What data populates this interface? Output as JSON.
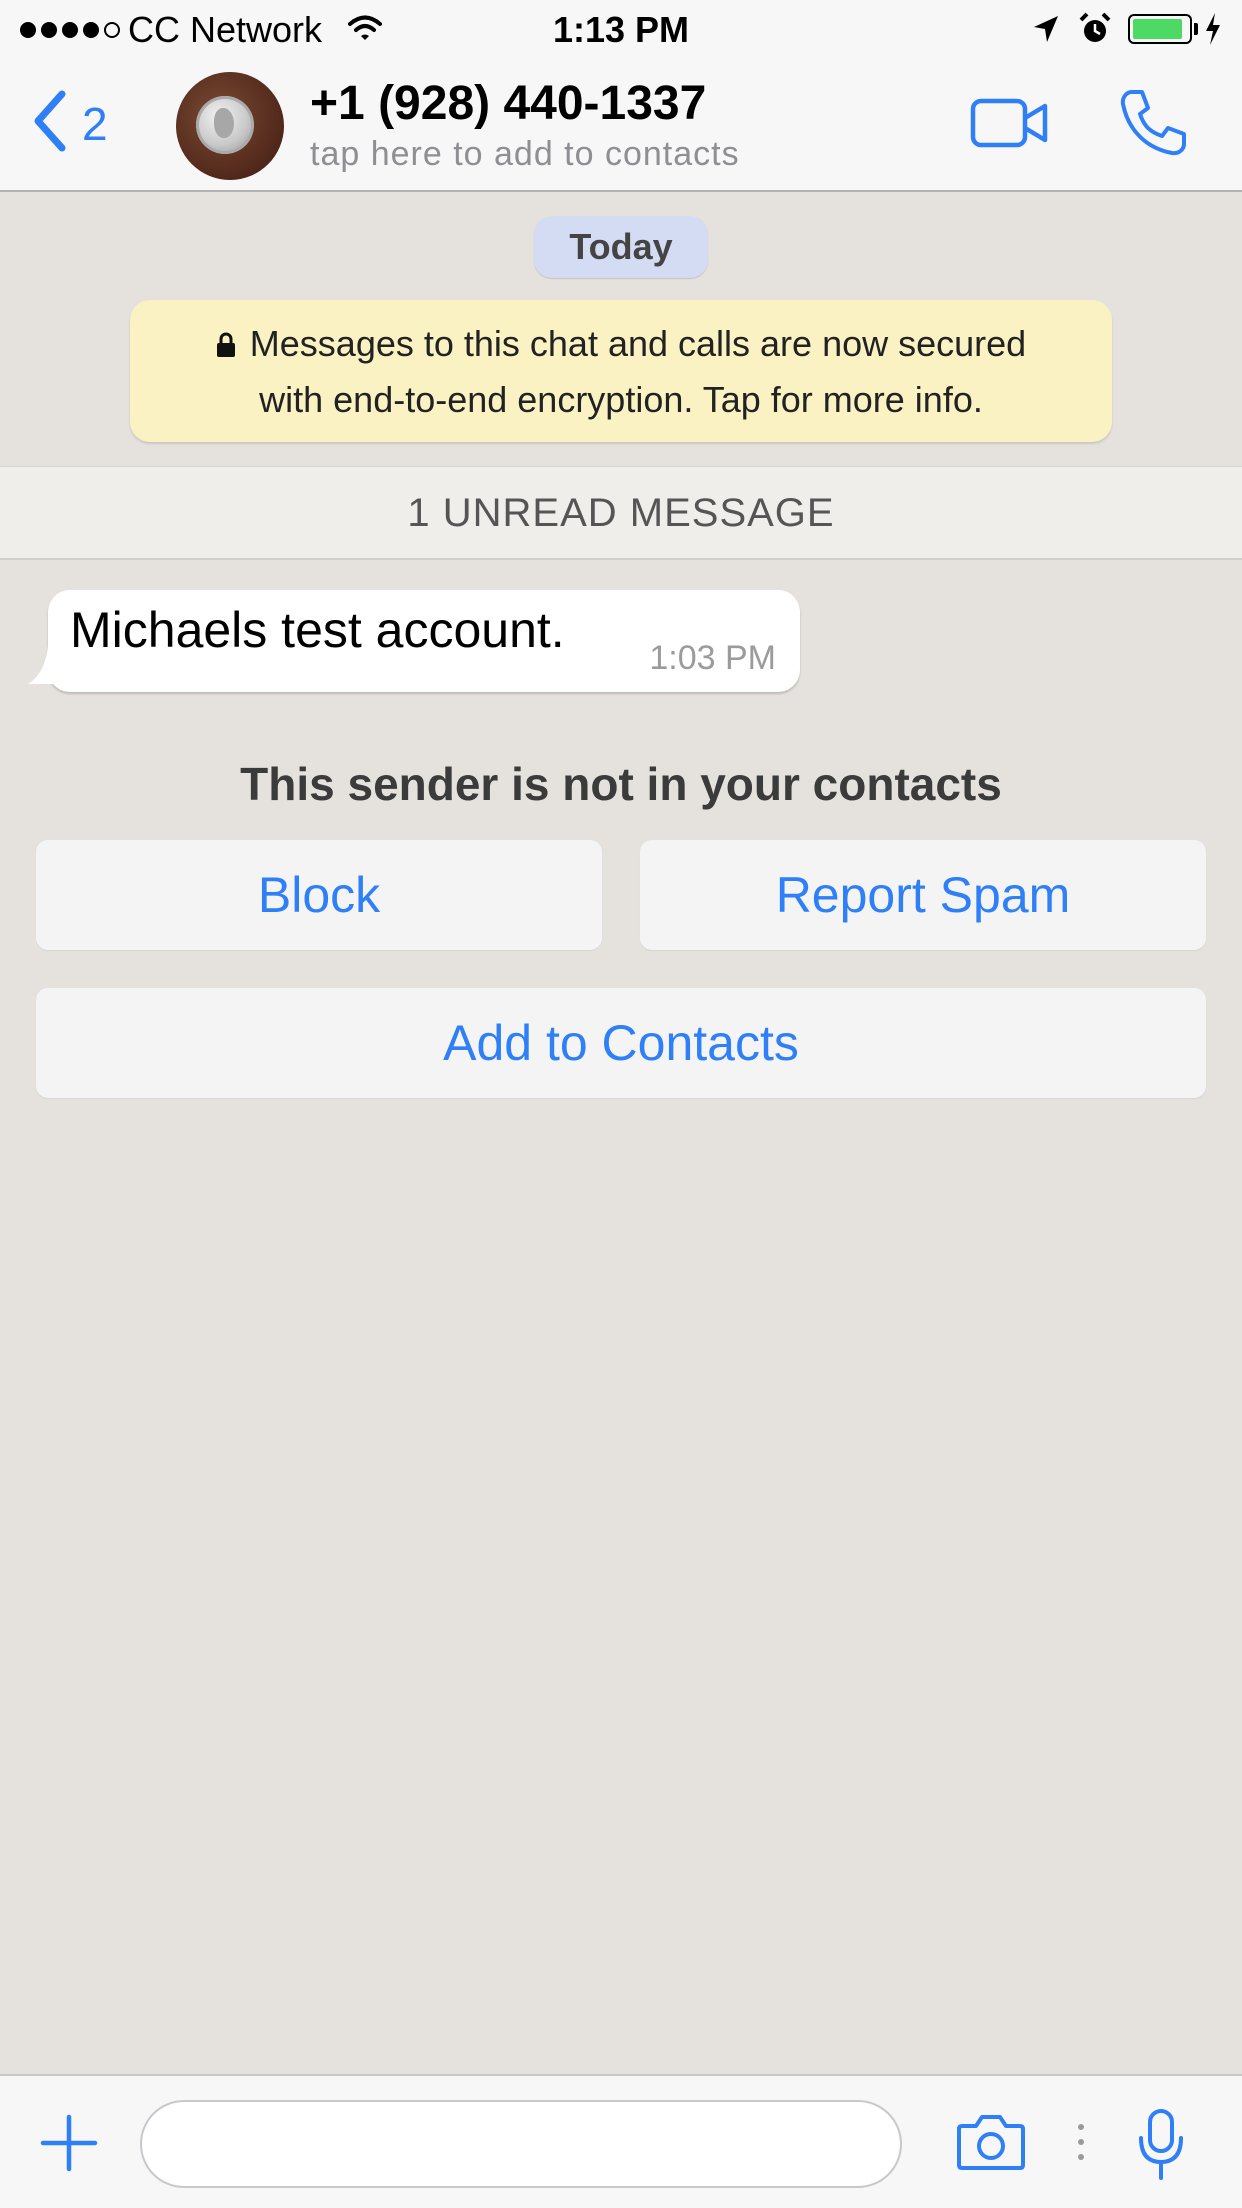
{
  "status_bar": {
    "carrier": "CC Network",
    "time": "1:13 PM",
    "signal_bars_filled": 4,
    "signal_bars_total": 5,
    "battery_level": 0.9,
    "icons": [
      "wifi-icon",
      "location-arrow-icon",
      "alarm-clock-icon",
      "battery-icon",
      "charging-bolt-icon"
    ]
  },
  "nav": {
    "back_count": "2",
    "contact_name": "+1 (928) 440-1337",
    "contact_subtitle": "tap here to add to contacts",
    "icons": [
      "chevron-left-icon",
      "video-camera-icon",
      "phone-icon"
    ]
  },
  "chat": {
    "date_label": "Today",
    "encryption_notice": {
      "line1": "Messages to this chat and calls are now secured",
      "line2": "with end-to-end encryption. Tap for more info."
    },
    "unread_label": "1 UNREAD MESSAGE",
    "messages": [
      {
        "text": "Michaels test account.",
        "time": "1:03 PM",
        "direction": "incoming"
      }
    ],
    "sender_notice": "This sender is not in your contacts",
    "actions": {
      "block": "Block",
      "report_spam": "Report Spam",
      "add_to_contacts": "Add to Contacts"
    }
  },
  "composer": {
    "input_value": "",
    "icons": [
      "plus-icon",
      "camera-icon",
      "more-dots-icon",
      "microphone-icon"
    ]
  },
  "colors": {
    "accent": "#2f7ff7",
    "chat_background": "#e5e2de",
    "encryption_notice_bg": "#faf2c2",
    "date_badge_bg": "#d3dcf2",
    "battery_fill": "#4cd964"
  }
}
